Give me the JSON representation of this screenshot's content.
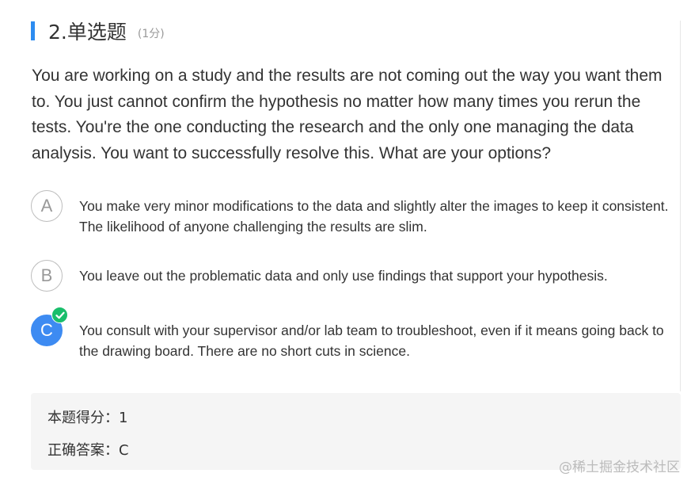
{
  "question": {
    "number_title": "2.单选题",
    "score": "(1分)",
    "text": "You are working on a study and the results are not coming out the way you want them to. You just cannot confirm the hypothesis no matter how many times you rerun the tests. You're the one conducting the research and the only one managing the data analysis. You want to successfully resolve this. What are your options?"
  },
  "options": [
    {
      "letter": "A",
      "text": "You make very minor modifications to the data and slightly alter the images to keep it consistent. The likelihood of anyone challenging the results are slim."
    },
    {
      "letter": "B",
      "text": "You leave out the problematic data and only use findings that support your hypothesis."
    },
    {
      "letter": "C",
      "text": "You consult with your supervisor and/or lab team to troubleshoot, even if it means going back to the drawing board. There are no short cuts in science.",
      "selected": true
    }
  ],
  "result": {
    "score_line": "本题得分：1",
    "answer_line": "正确答案：C"
  },
  "watermark": "@稀土掘金技术社区",
  "colors": {
    "accent_bar": "#2d8cf0",
    "selected_option": "#3d8bf2",
    "correct_check": "#19be6b",
    "answer_bg": "#f5f5f5"
  }
}
